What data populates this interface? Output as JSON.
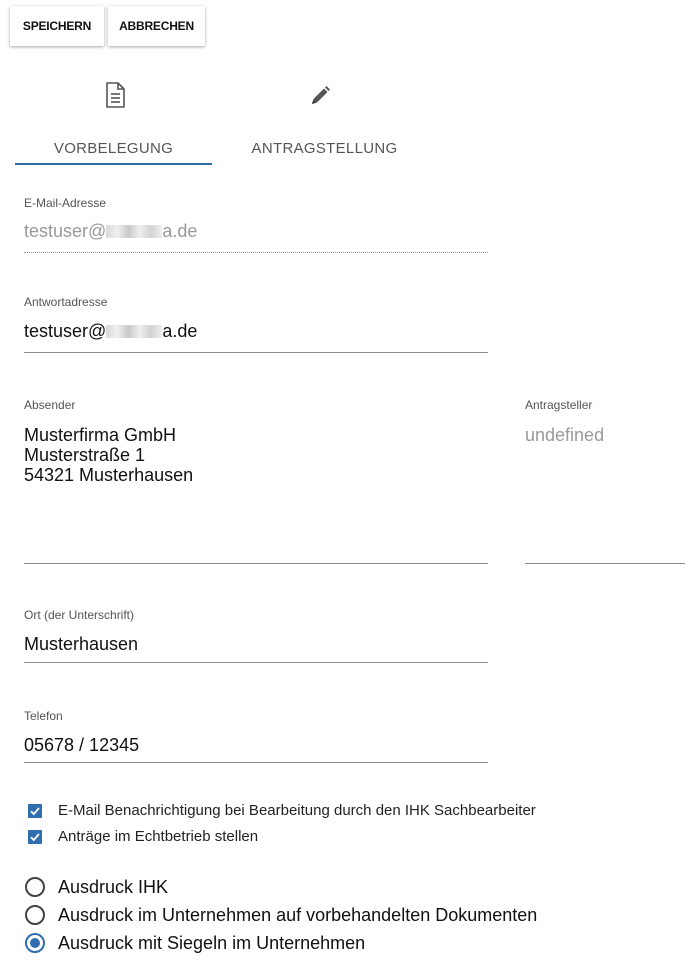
{
  "toolbar": {
    "save_label": "SPEICHERN",
    "cancel_label": "ABBRECHEN"
  },
  "tabs": [
    {
      "label": "VORBELEGUNG",
      "icon": "document-icon",
      "active": true
    },
    {
      "label": "ANTRAGSTELLUNG",
      "icon": "pencil-icon",
      "active": false
    }
  ],
  "email": {
    "label": "E-Mail-Adresse",
    "value_prefix": "testuser@",
    "value_suffix": "a.de"
  },
  "reply": {
    "label": "Antwortadresse",
    "value_prefix": "testuser@",
    "value_suffix": "a.de"
  },
  "sender": {
    "label": "Absender",
    "lines": [
      "Musterfirma GmbH",
      "Musterstraße 1",
      "54321 Musterhausen"
    ]
  },
  "applicant": {
    "label": "Antragsteller",
    "value": "undefined"
  },
  "place": {
    "label": "Ort (der Unterschrift)",
    "value": "Musterhausen"
  },
  "phone": {
    "label": "Telefon",
    "value": "05678 / 12345"
  },
  "checkboxes": [
    {
      "label": "E-Mail Benachrichtigung bei Bearbeitung durch den IHK Sachbearbeiter",
      "checked": true
    },
    {
      "label": "Anträge im Echtbetrieb stellen",
      "checked": true
    }
  ],
  "radios": [
    {
      "label": "Ausdruck IHK",
      "checked": false
    },
    {
      "label": "Ausdruck im Unternehmen auf vorbehandelten Dokumenten",
      "checked": false
    },
    {
      "label": "Ausdruck mit Siegeln im Unternehmen",
      "checked": true
    }
  ],
  "colors": {
    "accent": "#2f6db0",
    "tab_indicator": "#2e6aa3",
    "disabled_text": "#999999"
  }
}
